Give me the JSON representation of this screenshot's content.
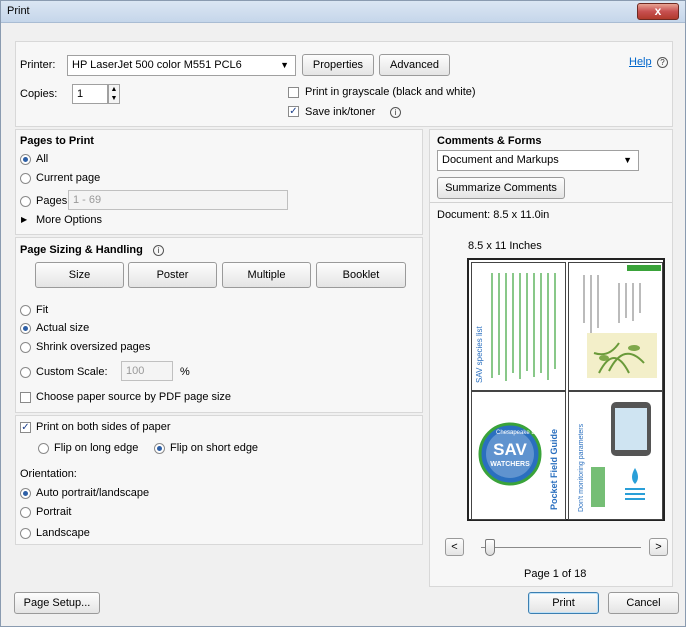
{
  "window": {
    "title": "Print",
    "close_label": "x"
  },
  "printer": {
    "label": "Printer:",
    "selected": "HP LaserJet 500 color M551 PCL6",
    "properties_label": "Properties",
    "advanced_label": "Advanced",
    "help_label": "Help"
  },
  "copies": {
    "label": "Copies:",
    "value": "1"
  },
  "options": {
    "grayscale_label": "Print in grayscale (black and white)",
    "grayscale_checked": false,
    "save_ink_label": "Save ink/toner",
    "save_ink_checked": true
  },
  "pages_to_print": {
    "heading": "Pages to Print",
    "all_label": "All",
    "current_label": "Current page",
    "pages_label": "Pages",
    "pages_placeholder": "1 - 69",
    "more_options_label": "More Options",
    "selected": "All"
  },
  "page_sizing": {
    "heading": "Page Sizing & Handling",
    "tabs": [
      "Size",
      "Poster",
      "Multiple",
      "Booklet"
    ],
    "fit_label": "Fit",
    "actual_label": "Actual size",
    "shrink_label": "Shrink oversized pages",
    "custom_label": "Custom Scale:",
    "custom_value": "100",
    "percent_label": "%",
    "paper_source_label": "Choose paper source by PDF page size",
    "selected": "Actual size"
  },
  "duplex": {
    "both_sides_label": "Print on both sides of paper",
    "both_sides_checked": true,
    "long_edge_label": "Flip on long edge",
    "short_edge_label": "Flip on short edge",
    "selected": "Flip on short edge"
  },
  "orientation": {
    "heading": "Orientation:",
    "auto_label": "Auto portrait/landscape",
    "portrait_label": "Portrait",
    "landscape_label": "Landscape",
    "selected": "Auto portrait/landscape"
  },
  "comments": {
    "heading": "Comments & Forms",
    "selected": "Document and Markups",
    "summarize_label": "Summarize Comments"
  },
  "document": {
    "size_label": "Document: 8.5 x 11.0in",
    "preview_size_label": "8.5 x 11 Inches",
    "page_indicator": "Page 1 of 18",
    "prev_label": "<",
    "next_label": ">",
    "preview_texts": {
      "sav_species": "SAV species list",
      "sav": "SAV",
      "watchers": "WATCHERS",
      "chesapeake": "Chesapeake Bay",
      "pocket_guide": "Pocket Field Guide",
      "monitoring": "Don't monitoring parameters"
    }
  },
  "footer": {
    "page_setup_label": "Page Setup...",
    "print_label": "Print",
    "cancel_label": "Cancel"
  },
  "colors": {
    "accent": "#2d5fa6",
    "link": "#0066cc",
    "close": "#c75050",
    "preview_green": "#3aa33a",
    "preview_blue": "#2a6fbf"
  }
}
